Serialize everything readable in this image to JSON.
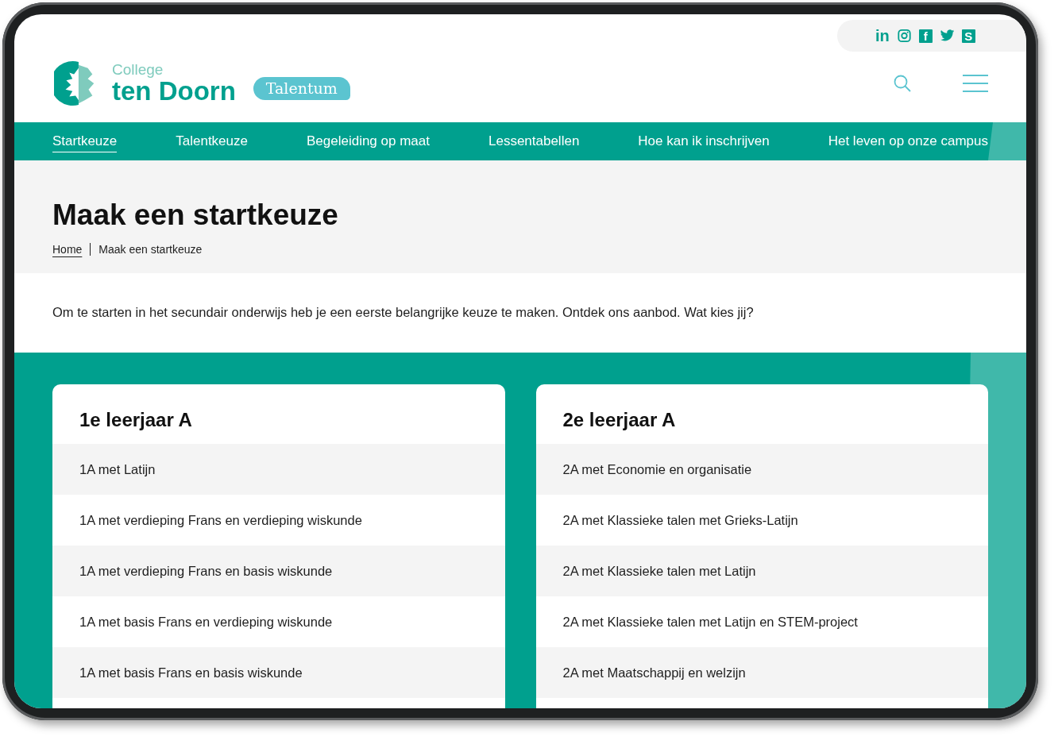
{
  "social": [
    {
      "kind": "linkedin",
      "glyph": "in"
    },
    {
      "kind": "instagram"
    },
    {
      "kind": "facebook",
      "glyph": "f"
    },
    {
      "kind": "twitter"
    },
    {
      "kind": "skype",
      "glyph": "S"
    }
  ],
  "logo": {
    "small": "College",
    "big": "ten Doorn",
    "badge": "Talentum"
  },
  "nav": [
    {
      "label": "Startkeuze",
      "selected": true
    },
    {
      "label": "Talentkeuze",
      "selected": false
    },
    {
      "label": "Begeleiding op maat",
      "selected": false
    },
    {
      "label": "Lessentabellen",
      "selected": false
    },
    {
      "label": "Hoe kan ik inschrijven",
      "selected": false
    },
    {
      "label": "Het leven op onze campus",
      "selected": false
    }
  ],
  "title": "Maak een startkeuze",
  "breadcrumb": [
    "Home",
    "Maak een startkeuze"
  ],
  "intro": "Om te starten in het secundair onderwijs heb je een eerste belangrijke keuze te maken. Ontdek ons aanbod. Wat kies jij?",
  "cards": [
    {
      "title": "1e leerjaar A",
      "items": [
        "1A met Latijn",
        "1A met verdieping Frans en verdieping wiskunde",
        "1A met verdieping Frans en basis wiskunde",
        "1A met basis Frans en verdieping wiskunde",
        "1A met basis Frans en basis wiskunde"
      ]
    },
    {
      "title": "2e leerjaar A",
      "items": [
        "2A met Economie en organisatie",
        "2A met Klassieke talen met Grieks-Latijn",
        "2A met Klassieke talen met Latijn",
        "2A met Klassieke talen met Latijn en STEM-project",
        "2A met Maatschappij en welzijn"
      ]
    }
  ]
}
